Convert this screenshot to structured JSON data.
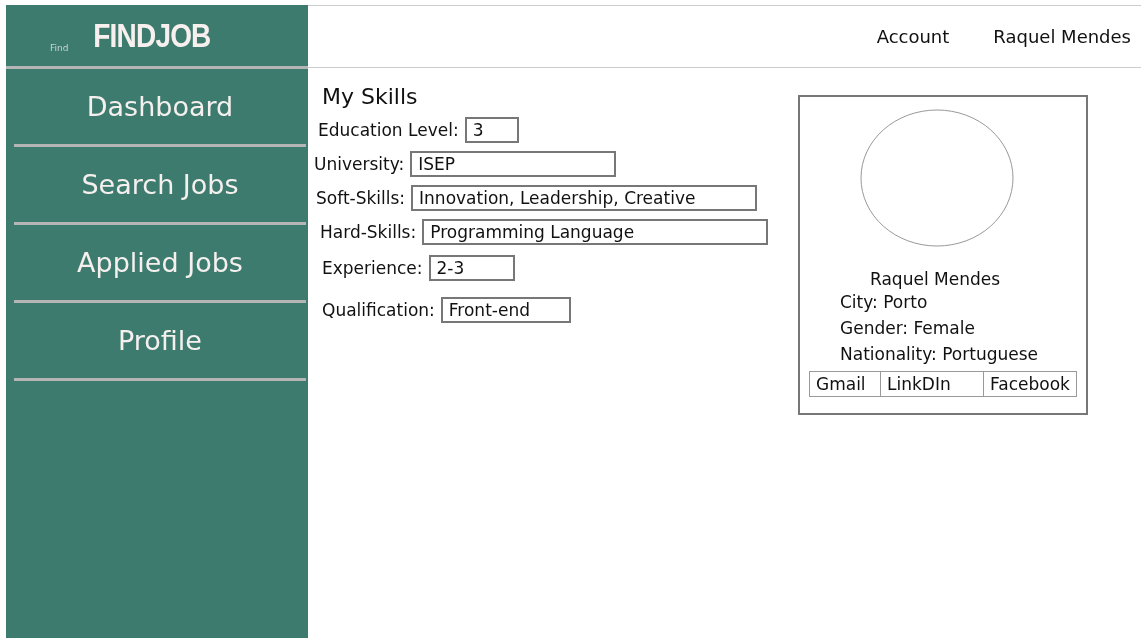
{
  "logo": {
    "caption": "Find",
    "title": "FINDJOB"
  },
  "top_nav": [
    "Account",
    "Raquel Mendes"
  ],
  "sidebar": {
    "items": [
      "Dashboard",
      "Search Jobs",
      "Applied Jobs",
      "Profile"
    ]
  },
  "skills": {
    "title": "My Skills",
    "fields": [
      {
        "label": "Education Level:",
        "value": "3"
      },
      {
        "label": "University:",
        "value": "ISEP"
      },
      {
        "label": "Soft-Skills:",
        "value": "Innovation, Leadership, Creative"
      },
      {
        "label": "Hard-Skills:",
        "value": "Programming Language"
      },
      {
        "label": "Experience:",
        "value": "2-3"
      },
      {
        "label": "Qualification:",
        "value": "Front-end"
      }
    ]
  },
  "profile_card": {
    "name": "Raquel Mendes",
    "details": [
      "City: Porto",
      "Gender: Female",
      "Nationality: Portuguese"
    ],
    "links": [
      "Gmail",
      "LinkDIn",
      "Facebook"
    ]
  }
}
